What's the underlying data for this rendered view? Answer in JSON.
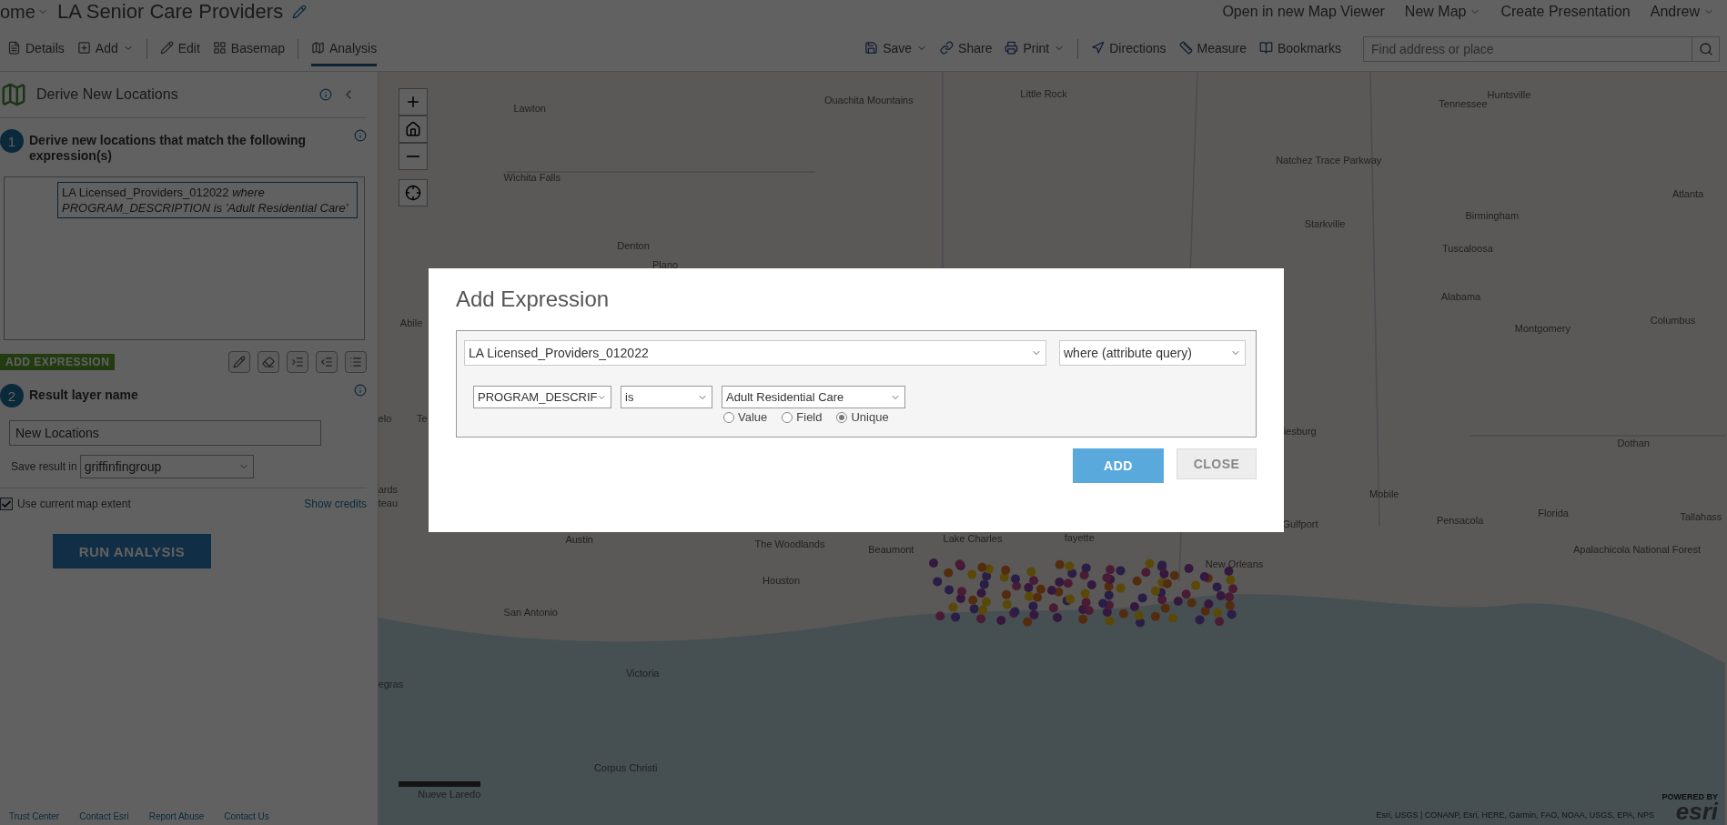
{
  "header": {
    "home": "ome",
    "title": "LA Senior Care Providers",
    "links": [
      {
        "label": "Open in new Map Viewer",
        "dropdown": false
      },
      {
        "label": "New Map",
        "dropdown": true
      },
      {
        "label": "Create Presentation",
        "dropdown": false
      }
    ],
    "user": "Andrew"
  },
  "toolbar": {
    "left": [
      {
        "label": "Details",
        "dropdown": false,
        "selected": false
      },
      {
        "label": "Add",
        "dropdown": true,
        "selected": false
      },
      {
        "label": "Edit",
        "dropdown": false,
        "selected": false
      },
      {
        "label": "Basemap",
        "dropdown": false,
        "selected": false
      },
      {
        "label": "Analysis",
        "dropdown": false,
        "selected": true
      }
    ],
    "right": [
      {
        "label": "Save",
        "dropdown": true
      },
      {
        "label": "Share",
        "dropdown": false
      },
      {
        "label": "Print",
        "dropdown": true
      },
      {
        "label": "Directions",
        "dropdown": false
      },
      {
        "label": "Measure",
        "dropdown": false
      },
      {
        "label": "Bookmarks",
        "dropdown": false
      }
    ],
    "search": {
      "placeholder": "Find address or place"
    }
  },
  "panel": {
    "title": "Derive New Locations",
    "steps": [
      {
        "number": "1",
        "label": "Derive new locations that match the following expression(s)"
      },
      {
        "number": "2",
        "label": "Result layer name"
      }
    ],
    "expressions": [
      "LA Licensed_Providers_012022 *where PROGRAM_DESCRIPTION is 'Adult Residential Care'*"
    ],
    "add_expression": "ADD EXPRESSION",
    "result_name": "New Locations",
    "save_label": "Save result in",
    "save_folder": "griffinfingroup",
    "use_extent": {
      "label": "Use current map extent",
      "checked": true
    },
    "show_credits": "Show credits",
    "run": "RUN ANALYSIS"
  },
  "map": {
    "labels": [
      "Lawton",
      "Ouachita Mountains",
      "Little Rock",
      "Huntsville",
      "Tennessee",
      "Natchez Trace Parkway",
      "Wichita Falls",
      "Atlanta",
      "Birmingham",
      "Starkville",
      "Denton",
      "Plano",
      "Tuscaloosa",
      "Alabama",
      "Montgomery",
      "Columbus",
      "Abile",
      "elo",
      "Te",
      "ards",
      "teau",
      "iesburg",
      "Dothan",
      "Mobile",
      "Pensacola",
      "Florida",
      "Tallahass",
      "Gulfport",
      "Austin",
      "Lake Charles",
      "fayette",
      "The Woodlands",
      "Beaumont",
      "New Orleans",
      "Houston",
      "Apalachicola National Forest",
      "San Antonio",
      "Victoria",
      "egras",
      "Corpus Christi",
      "Nueve Laredo"
    ],
    "attribution": "Esri, USGS | CONANP, Esri, HERE, Garmin, FAO, NOAA, USGS, EPA, NPS",
    "logo_caption": "POWERED BY",
    "logo": "esri"
  },
  "footer": {
    "links": [
      "Trust Center",
      "Contact Esri",
      "Report Abuse",
      "Contact Us"
    ]
  },
  "dialog": {
    "title": "Add Expression",
    "layer": "LA Licensed_Providers_012022",
    "query": "where (attribute query)",
    "field": "PROGRAM_DESCRIF",
    "operator": "is",
    "value": "Adult Residential Care",
    "modes": [
      {
        "label": "Value",
        "selected": false
      },
      {
        "label": "Field",
        "selected": false
      },
      {
        "label": "Unique",
        "selected": true
      }
    ],
    "buttons": [
      {
        "label": "ADD",
        "kind": "primary"
      },
      {
        "label": "CLOSE",
        "kind": "secondary"
      }
    ]
  }
}
